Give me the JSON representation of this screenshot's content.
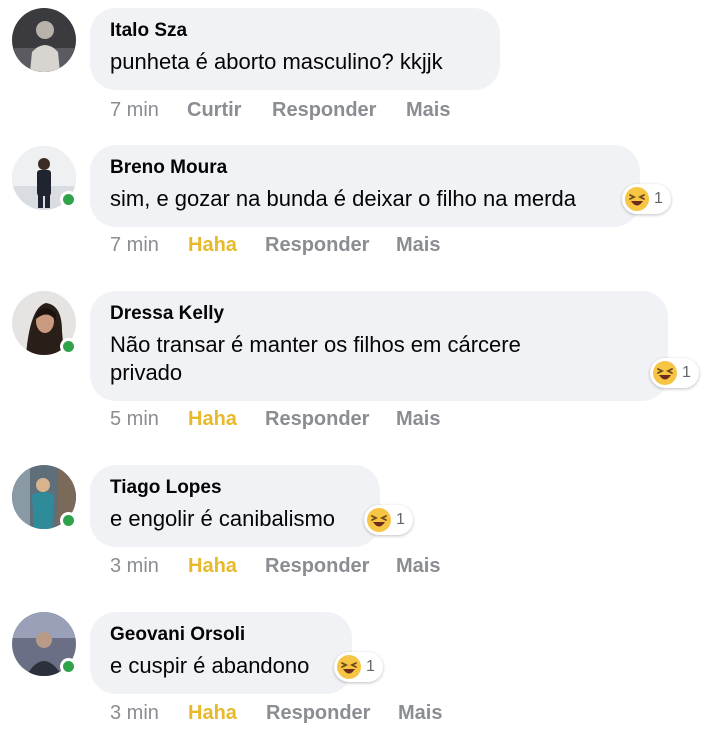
{
  "comments": [
    {
      "name": "Italo Sza",
      "text": "punheta é aborto masculino? kkjjk",
      "time": "7 min",
      "like_label": "Curtir",
      "reply_label": "Responder",
      "more_label": "Mais",
      "online": false,
      "reaction_count": null
    },
    {
      "name": "Breno Moura",
      "text": "sim, e gozar na bunda é deixar o filho na merda",
      "time": "7 min",
      "like_label": "Haha",
      "reply_label": "Responder",
      "more_label": "Mais",
      "online": true,
      "reaction": "haha-emoji-icon",
      "reaction_count": "1"
    },
    {
      "name": "Dressa Kelly",
      "text_line1": "Não transar é manter os filhos em cárcere",
      "text_line2": "privado",
      "time": "5 min",
      "like_label": "Haha",
      "reply_label": "Responder",
      "more_label": "Mais",
      "online": true,
      "reaction": "haha-emoji-icon",
      "reaction_count": "1"
    },
    {
      "name": "Tiago Lopes",
      "text": "e engolir é canibalismo",
      "time": "3 min",
      "like_label": "Haha",
      "reply_label": "Responder",
      "more_label": "Mais",
      "online": true,
      "reaction": "haha-emoji-icon",
      "reaction_count": "1"
    },
    {
      "name": "Geovani Orsoli",
      "text": "e cuspir é abandono",
      "time": "3 min",
      "like_label": "Haha",
      "reply_label": "Responder",
      "more_label": "Mais",
      "online": true,
      "reaction": "haha-emoji-icon",
      "reaction_count": "1"
    }
  ],
  "colors": {
    "bubble": "#f0f2f5",
    "online": "#31a24c",
    "haha": "#e8b92b",
    "meta": "#8a8d91"
  }
}
